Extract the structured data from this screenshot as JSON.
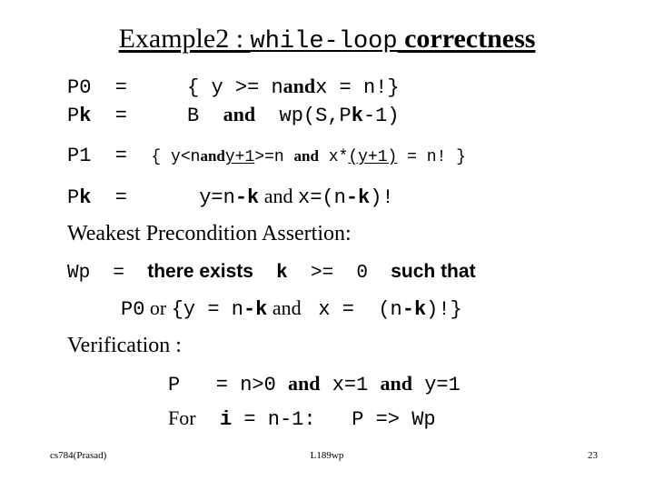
{
  "slide": {
    "title": {
      "part1": "Example2 : ",
      "part2": "while-loop",
      "part3": " correctness"
    },
    "lines": {
      "p0": {
        "label": "P0",
        "eq": "  =  ",
        "open": "   { ",
        "cond1": "y >= n",
        "and": "and",
        "cond2": "x = n!",
        "close": "}"
      },
      "pk1": {
        "label_p": "P",
        "label_k": "k",
        "eq": "  =  ",
        "b": "   B  ",
        "and": "and",
        "wp_pre": "  wp(S,P",
        "wp_k": "k",
        "wp_post": "-1)"
      },
      "p1": {
        "label": "P1",
        "eq": "  =  ",
        "open": "{ ",
        "cond1": "y<n",
        "and1": "and",
        "u1": "y+1",
        "cond2": ">=n ",
        "and2": "and",
        "cond3": " x*",
        "u2": "(y+1)",
        "cond4": " = n! }"
      },
      "pk2": {
        "label_p": "P",
        "label_k": "k",
        "eq": "  =  ",
        "lhs_pre": "    y=n",
        "lhs_dash": "-",
        "lhs_k": "k",
        "and": " and ",
        "rhs_pre": "x=(n",
        "rhs_dash": "-",
        "rhs_k": "k",
        "rhs_post": ")!"
      },
      "wpa": "Weakest Precondition Assertion:",
      "wp": {
        "label": "Wp",
        "eq": "  =  ",
        "there_exists": "there exists",
        "k": "  k  ",
        "ge": ">= ",
        "zero": " 0  ",
        "such_that": "such that"
      },
      "p0or": {
        "p0": "P0",
        "or": " or ",
        "open": "{y = n",
        "dash1": "-",
        "k1": "k",
        "and": " and ",
        "x": " x = ",
        "open2": " (n",
        "dash2": "-",
        "k2": "k",
        "close": ")!}"
      },
      "verification": "Verification :",
      "pv": {
        "p": "P",
        "eq": "   = ",
        "cond1": "n>0 ",
        "and1": "and",
        "cond2": " x=1 ",
        "and2": "and",
        "cond3": " y=1"
      },
      "for": {
        "for": "For",
        "i": "  i",
        "eq": " = ",
        "n": "n-1:",
        "p": "   P ",
        "implies": "=> ",
        "wp": "Wp"
      }
    },
    "footer": {
      "left": "cs784(Prasad)",
      "middle": "L189wp",
      "right": "23"
    }
  }
}
